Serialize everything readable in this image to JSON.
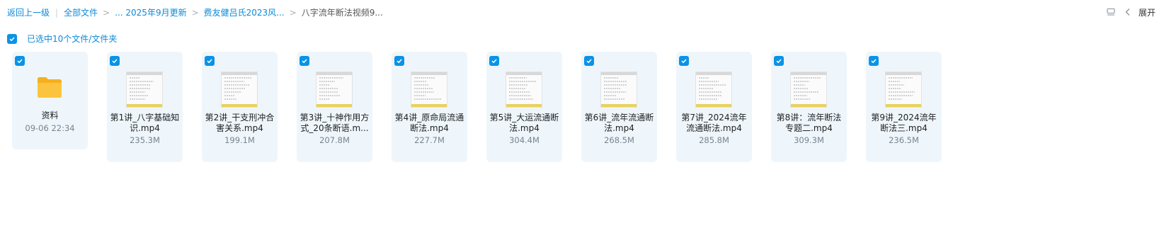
{
  "breadcrumb": {
    "back": "返回上一级",
    "all_files": "全部文件",
    "items": [
      "... 2025年9月更新",
      "费友健吕氏2023风...",
      "八字流年断法视频9..."
    ]
  },
  "top_right": {
    "open_label": "展开"
  },
  "selection": {
    "text": "已选中10个文件/文件夹"
  },
  "files": [
    {
      "name": "资料",
      "meta": "09-06 22:34",
      "type": "folder",
      "selected": true
    },
    {
      "name": "第1讲_八字基础知识.mp4",
      "meta": "235.3M",
      "type": "video",
      "selected": true
    },
    {
      "name": "第2讲_干支刑冲合害关系.mp4",
      "meta": "199.1M",
      "type": "video",
      "selected": true
    },
    {
      "name": "第3讲_十神作用方式_20条断语.m...",
      "meta": "207.8M",
      "type": "video",
      "selected": true
    },
    {
      "name": "第4讲_原命局流通断法.mp4",
      "meta": "227.7M",
      "type": "video",
      "selected": true
    },
    {
      "name": "第5讲_大运流通断法.mp4",
      "meta": "304.4M",
      "type": "video",
      "selected": true
    },
    {
      "name": "第6讲_流年流通断法.mp4",
      "meta": "268.5M",
      "type": "video",
      "selected": true
    },
    {
      "name": "第7讲_2024流年流通断法.mp4",
      "meta": "285.8M",
      "type": "video",
      "selected": true
    },
    {
      "name": "第8讲：流年断法专题二.mp4",
      "meta": "309.3M",
      "type": "video",
      "selected": true
    },
    {
      "name": "第9讲_2024流年断法三.mp4",
      "meta": "236.5M",
      "type": "video",
      "selected": true
    }
  ],
  "colors": {
    "accent": "#0b93e6",
    "link": "#0b8ad8",
    "card_bg": "#eef6fc",
    "folder": "#f7b928"
  }
}
